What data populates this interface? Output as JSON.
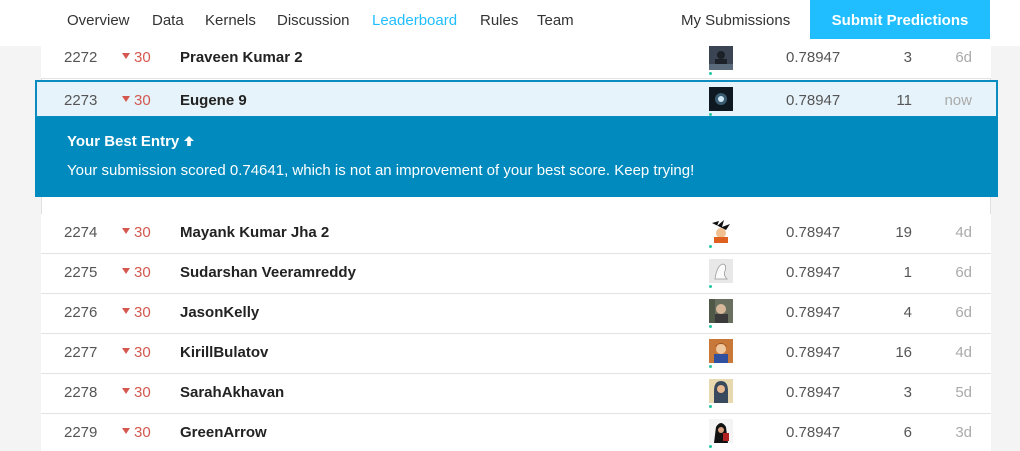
{
  "nav": {
    "tabs": [
      "Overview",
      "Data",
      "Kernels",
      "Discussion",
      "Leaderboard",
      "Rules",
      "Team"
    ],
    "active_tab": "Leaderboard",
    "my_submissions": "My Submissions",
    "submit": "Submit Predictions"
  },
  "banner": {
    "title": "Your Best Entry",
    "message": "Your submission scored 0.74641, which is not an improvement of your best score. Keep trying!"
  },
  "rows": [
    {
      "rank": "2272",
      "change": "30",
      "team": "Praveen Kumar 2",
      "score": "0.78947",
      "entries": "3",
      "last": "6d",
      "avatar": "dark-figure"
    },
    {
      "rank": "2273",
      "change": "30",
      "team": "Eugene 9",
      "score": "0.78947",
      "entries": "11",
      "last": "now",
      "avatar": "glowing-orb"
    },
    {
      "rank": "2274",
      "change": "30",
      "team": "Mayank Kumar Jha 2",
      "score": "0.78947",
      "entries": "19",
      "last": "4d",
      "avatar": "anime-character"
    },
    {
      "rank": "2275",
      "change": "30",
      "team": "Sudarshan Veeramreddy",
      "score": "0.78947",
      "entries": "1",
      "last": "6d",
      "avatar": "sketch"
    },
    {
      "rank": "2276",
      "change": "30",
      "team": "JasonKelly",
      "score": "0.78947",
      "entries": "4",
      "last": "6d",
      "avatar": "photo-person"
    },
    {
      "rank": "2277",
      "change": "30",
      "team": "KirillBulatov",
      "score": "0.78947",
      "entries": "16",
      "last": "4d",
      "avatar": "photo-portrait"
    },
    {
      "rank": "2278",
      "change": "30",
      "team": "SarahAkhavan",
      "score": "0.78947",
      "entries": "3",
      "last": "5d",
      "avatar": "photo-woman"
    },
    {
      "rank": "2279",
      "change": "30",
      "team": "GreenArrow",
      "score": "0.78947",
      "entries": "6",
      "last": "3d",
      "avatar": "hooded-figure"
    }
  ],
  "colors": {
    "accent": "#20beff",
    "banner": "#008abd",
    "highlight_row": "#e6f3fa",
    "rank_drop": "#d4584f"
  }
}
